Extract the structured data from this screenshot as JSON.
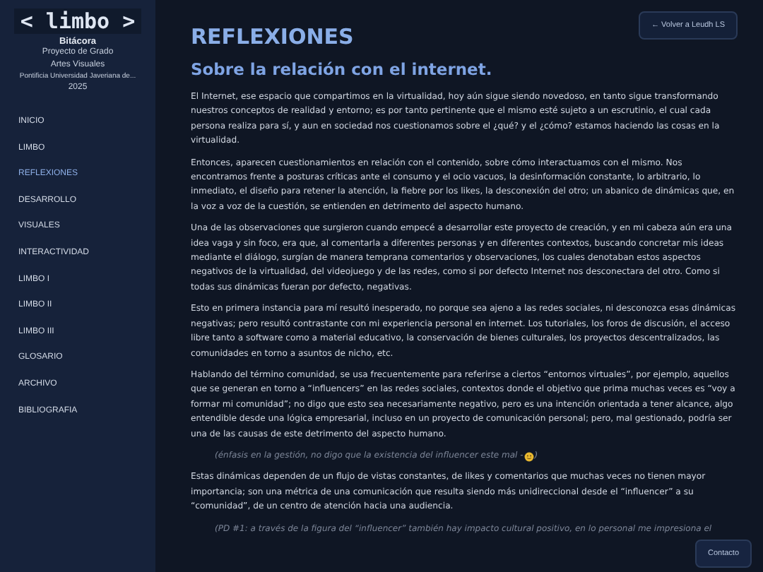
{
  "sidebar": {
    "logo": "< limbo >",
    "title": "Bitácora",
    "subtitle_lines": [
      "Proyecto de Grado",
      "Artes Visuales",
      "Pontificia Universidad Javeriana de...",
      "2025"
    ],
    "items": [
      {
        "label": "INICIO",
        "selected": false
      },
      {
        "label": "LIMBO",
        "selected": false
      },
      {
        "label": "REFLEXIONES",
        "selected": true
      },
      {
        "label": "DESARROLLO",
        "selected": false
      },
      {
        "label": "VISUALES",
        "selected": false
      },
      {
        "label": "INTERACTIVIDAD",
        "selected": false
      },
      {
        "label": "LIMBO I",
        "selected": false
      },
      {
        "label": "LIMBO II",
        "selected": false
      },
      {
        "label": "LIMBO III",
        "selected": false
      },
      {
        "label": "GLOSARIO",
        "selected": false
      },
      {
        "label": "ARCHIVO",
        "selected": false
      },
      {
        "label": "BIBLIOGRAFIA",
        "selected": false
      }
    ]
  },
  "back_button": "← Volver a Leudh LS",
  "page_title": "REFLEXIONES",
  "section_title": "Sobre la relación con el internet.",
  "blocks": [
    {
      "kind": "paragraph",
      "text": "El Internet, ese espacio que compartimos en la virtualidad, hoy aún sigue siendo novedoso, en tanto sigue transformando nuestros conceptos de realidad y entorno; es por tanto pertinente que el mismo esté sujeto a un escrutinio, el cual cada persona realiza para sí, y aun en sociedad nos cuestionamos sobre el ¿qué? y el ¿cómo? estamos haciendo las cosas en la virtualidad."
    },
    {
      "kind": "paragraph",
      "text": "Entonces, aparecen cuestionamientos en relación con el contenido, sobre cómo interactuamos con el mismo. Nos encontramos frente a posturas críticas ante el consumo y el ocio vacuos, la desinformación constante, lo arbitrario, lo inmediato, el diseño para retener la atención, la fiebre por los likes, la desconexión del otro; un abanico de dinámicas que, en la voz a voz de la cuestión, se entienden en detrimento del aspecto humano."
    },
    {
      "kind": "paragraph",
      "text": "Una de las observaciones que surgieron cuando empecé a desarrollar este proyecto de creación, y en mi cabeza aún era una idea vaga y sin foco, era que, al comentarla a diferentes personas y en diferentes contextos, buscando concretar mis ideas mediante el diálogo, surgían de manera temprana comentarios y observaciones, los cuales denotaban estos aspectos negativos de la virtualidad, del videojuego y de las redes, como si por defecto Internet nos desconectara del otro. Como si todas sus dinámicas fueran por defecto, negativas."
    },
    {
      "kind": "paragraph",
      "text": "Esto en primera instancia para mí resultó inesperado, no porque sea ajeno a las redes sociales, ni desconozca esas dinámicas negativas; pero resultó contrastante con mi experiencia personal en internet. Los tutoriales, los foros de discusión, el acceso libre tanto a software como a material educativo, la conservación de bienes culturales, los proyectos descentralizados, las comunidades en torno a asuntos de nicho, etc."
    },
    {
      "kind": "paragraph",
      "text": "Hablando del término comunidad, se usa frecuentemente para referirse a ciertos “entornos virtuales”, por ejemplo, aquellos que se generan en torno a “influencers” en las redes sociales, contextos donde el objetivo que prima muchas veces es “voy a formar mi comunidad”; no digo que esto sea necesariamente negativo, pero es una intención orientada a tener alcance, algo entendible desde una lógica empresarial, incluso en un proyecto de comunicación personal; pero, mal gestionado, podría ser una de las causas de este detrimento del aspecto humano."
    },
    {
      "kind": "note",
      "text": "(énfasis en la gestión, no digo que la existencia del influencer este mal -",
      "emoji": true,
      "close": ")"
    },
    {
      "kind": "paragraph",
      "text": "Estas dinámicas dependen de un flujo de vistas constantes, de likes y comentarios que muchas veces no tienen mayor importancia; son una métrica de una comunicación que resulta siendo más unidireccional desde el “influencer” a su “comunidad”, de un centro de atención hacia una audiencia."
    },
    {
      "kind": "note",
      "text": "(PD #1: a través de la figura del “influencer” también hay impacto cultural positivo, en lo personal me impresiona el"
    }
  ],
  "contact_button": "Contacto"
}
